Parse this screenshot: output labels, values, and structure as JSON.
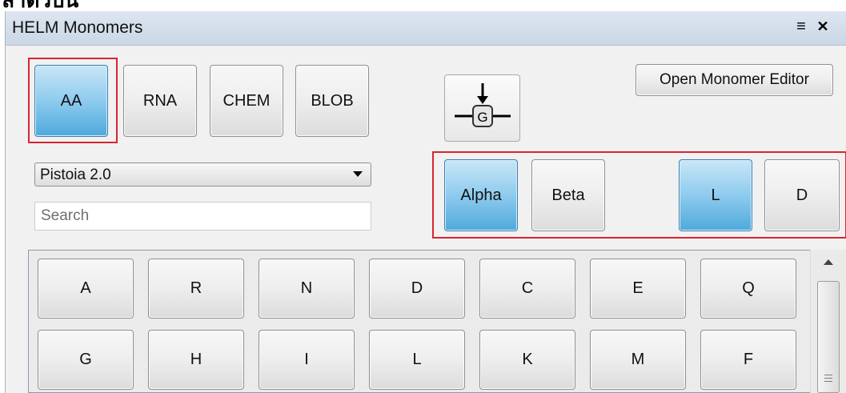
{
  "clipped_top_text": "ลำตัวบน",
  "window": {
    "title": "HELM Monomers",
    "menu_glyph": "≡",
    "close_glyph": "✕"
  },
  "type_tabs": [
    {
      "label": "AA",
      "active": true
    },
    {
      "label": "RNA",
      "active": false
    },
    {
      "label": "CHEM",
      "active": false
    },
    {
      "label": "BLOB",
      "active": false
    }
  ],
  "open_editor_label": "Open Monomer Editor",
  "g_icon_letter": "G",
  "library": {
    "selected": "Pistoia 2.0"
  },
  "search": {
    "placeholder": "Search",
    "value": ""
  },
  "filters": {
    "backbone": [
      {
        "label": "Alpha",
        "active": true
      },
      {
        "label": "Beta",
        "active": false
      }
    ],
    "chirality": [
      {
        "label": "L",
        "active": true
      },
      {
        "label": "D",
        "active": false
      }
    ]
  },
  "monomers": {
    "row1": [
      "A",
      "R",
      "N",
      "D",
      "C",
      "E",
      "Q"
    ],
    "row2": [
      "G",
      "H",
      "I",
      "L",
      "K",
      "M",
      "F"
    ]
  },
  "colors": {
    "highlight": "#d9242f",
    "active_button": "#4fa9dc"
  }
}
